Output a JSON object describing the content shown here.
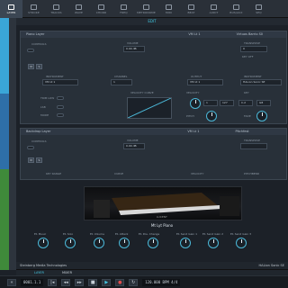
{
  "toolbar": {
    "tools": [
      "LAYER",
      "STROKE",
      "TRACKS",
      "WAVE",
      "CHORD",
      "FREQ",
      "METRONOME",
      "MIDI",
      "BEAT",
      "AUDIT",
      "BUS/AUX",
      "SEQ"
    ],
    "active_index": 0
  },
  "subheader": {
    "label": "EDIT"
  },
  "layer1": {
    "title": "Piano Layer",
    "vm": "VM Lt 1",
    "preset_hint": "Virtuos Barrio S0",
    "controls_label": "CONTROLS",
    "volume_label": "VOLUME",
    "volume_value": "0.00 dB",
    "transpose_label": "TRANSPOSE",
    "transpose_value": "0",
    "key_off_label": "KEY OFF",
    "instrument_label": "INSTRUMENT",
    "channel_label": "CHANNEL",
    "channel_value": "1",
    "output_label": "OUTPUT",
    "output_value": "HALion Sonic SE",
    "vm_value": "VM Lt 1",
    "velocity_curve_label": "VELOCITY CURVE",
    "velocity_label": "VELOCITY",
    "vel_value": "1",
    "vel_high": "127",
    "key_label": "KEY",
    "key_low": "C-2",
    "key_high": "G8",
    "pitch_label": "PITCH",
    "fade_label": "FADE",
    "buttons": [
      "M",
      "S"
    ]
  },
  "layer2": {
    "title": "Backdrop Layer",
    "vm": "VM Lt 1",
    "preset_hint": "Pitchfest",
    "controls_label": "CONTROLS",
    "volume_label": "VOLUME",
    "volume_value": "0.00 dB",
    "transpose_label": "TRANSPOSE",
    "buttons": [
      "M",
      "S"
    ],
    "row_labels": [
      "KEY RANGE",
      "CURVE",
      "VELOCITY",
      "PITCHBEND"
    ]
  },
  "piano": {
    "name": "Mt Lyt Piano",
    "brand": "LUCENT",
    "controls": [
      "E1 Music",
      "E1 Solo",
      "E1 Volume",
      "E1 Attack",
      "E1 Pos. Change",
      "E1 Send Gain 1",
      "E1 Send Gain 2",
      "E1 Send Gain 3"
    ]
  },
  "status": {
    "left": "Steinberg Media Technologies",
    "right": "HALion Sonic SE"
  },
  "tabs": [
    "LAYER",
    "MIXER"
  ],
  "transport": {
    "counter": "0001.1.1",
    "tempo": "120.000 BPM 4/4"
  },
  "colors": {
    "accent": "#45c8e4",
    "record": "#e24b4b"
  }
}
